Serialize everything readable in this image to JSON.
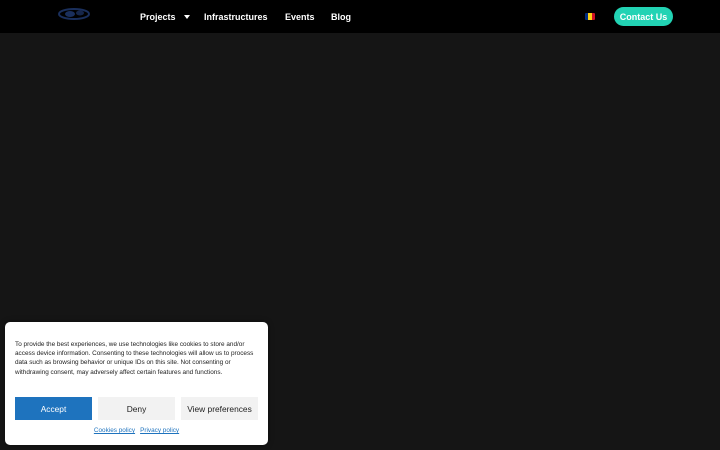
{
  "header": {
    "nav": [
      {
        "label": "Projects",
        "has_dropdown": true
      },
      {
        "label": "Infrastructures"
      },
      {
        "label": "Events"
      },
      {
        "label": "Blog"
      }
    ],
    "language_flag": {
      "icon": "romania-flag-icon",
      "colors": [
        "#002b7f",
        "#fcd116",
        "#ce1126"
      ]
    },
    "contact_label": "Contact Us",
    "accent_color": "#22d3b4"
  },
  "cookie_banner": {
    "message": "To provide the best experiences, we use technologies like cookies to store and/or access device information. Consenting to these technologies will allow us to process data such as browsing behavior or unique IDs on this site. Not consenting or withdrawing consent, may adversely affect certain features and functions.",
    "accept_label": "Accept",
    "deny_label": "Deny",
    "preferences_label": "View preferences",
    "links": [
      {
        "label": "Cookies policy"
      },
      {
        "label": "Privacy policy"
      }
    ],
    "accent_color": "#1e73be"
  }
}
